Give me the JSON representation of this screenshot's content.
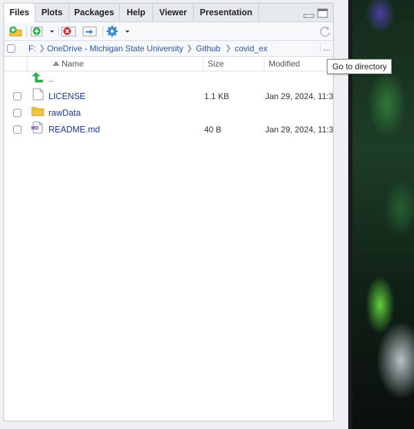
{
  "tabs": [
    {
      "label": "Files",
      "active": true
    },
    {
      "label": "Plots"
    },
    {
      "label": "Packages"
    },
    {
      "label": "Help"
    },
    {
      "label": "Viewer"
    },
    {
      "label": "Presentation"
    }
  ],
  "toolbar": {
    "new_folder_icon": "new-folder-icon",
    "new_file_icon": "new-blank-file-icon",
    "delete_icon": "delete-icon",
    "rename_icon": "rename-icon",
    "more_icon": "gear-icon",
    "refresh_icon": "refresh-icon"
  },
  "breadcrumb": {
    "items": [
      "F:",
      "OneDrive - Michigan State University",
      "Github",
      "covid_ex"
    ],
    "more_label": "..."
  },
  "columns": {
    "name": "Name",
    "size": "Size",
    "modified": "Modified",
    "sort": "ascending"
  },
  "parent_row": {
    "label": ".."
  },
  "files": [
    {
      "name": "LICENSE",
      "size": "1.1 KB",
      "modified": "Jan 29, 2024, 11:3",
      "icon": "text-file-icon"
    },
    {
      "name": "rawData",
      "size": "",
      "modified": "",
      "icon": "folder-icon"
    },
    {
      "name": "README.md",
      "size": "40 B",
      "modified": "Jan 29, 2024, 11:3",
      "icon": "markdown-file-icon"
    }
  ],
  "tooltip": {
    "text": "Go to directory"
  },
  "colors": {
    "link": "#1b3a9a",
    "crumb": "#2a56a8",
    "tab_bar": "#e6e9ee",
    "accent_green": "#2bb24c"
  }
}
